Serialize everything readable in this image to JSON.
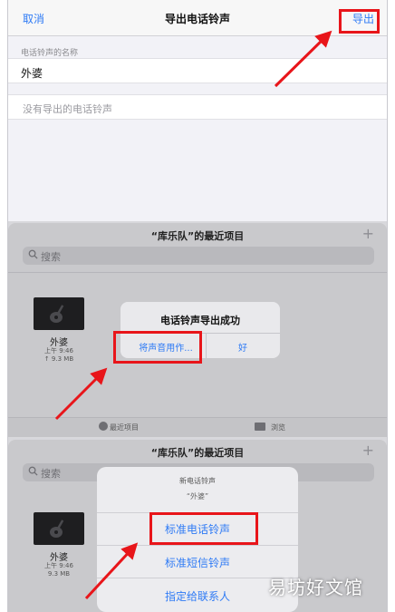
{
  "panel1": {
    "cancel": "取消",
    "title": "导出电话铃声",
    "export": "导出",
    "section_label": "电话铃声的名称",
    "ringtone_name": "外婆",
    "no_exported": "没有导出的电话铃声"
  },
  "panel2": {
    "title": "“库乐队”的最近项目",
    "search_placeholder": "搜索",
    "file": {
      "name": "外婆",
      "time": "上午 9:46",
      "size": "↑ 9.3 MB"
    },
    "alert": {
      "title": "电话铃声导出成功",
      "use_as": "将声音用作...",
      "ok": "好"
    },
    "tabs": {
      "recent": "最近项目",
      "browse": "浏览"
    }
  },
  "panel3": {
    "title": "“库乐队”的最近项目",
    "search_placeholder": "搜索",
    "file": {
      "name": "外婆",
      "time": "上午 9:46",
      "size": "9.3 MB"
    },
    "sheet": {
      "title": "新电话铃声",
      "subtitle": "“外婆”",
      "options": [
        "标准电话铃声",
        "标准短信铃声",
        "指定给联系人"
      ]
    }
  },
  "watermark": "易坊好文馆",
  "colors": {
    "accent": "#2f7bf5",
    "highlight": "#e8151a"
  }
}
